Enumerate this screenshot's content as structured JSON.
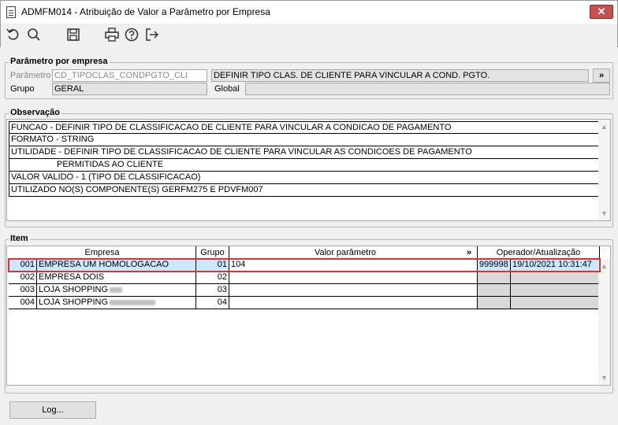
{
  "window": {
    "title": "ADMFM014 - Atribuição de Valor a Parâmetro por Empresa",
    "close_label": "✕"
  },
  "toolbar": {
    "icons": [
      "undo-icon",
      "search-icon",
      "save-icon",
      "print-icon",
      "help-icon",
      "exit-icon"
    ]
  },
  "parametro_group": {
    "title": "Parâmetro por empresa",
    "parametro_label": "Parâmetro",
    "parametro_value": "CD_TIPOCLAS_CONDPGTO_CLI",
    "parametro_desc": "DEFINIR TIPO CLAS. DE CLIENTE PARA VINCULAR A COND. PGTO.",
    "expand_label": "»",
    "grupo_label": "Grupo",
    "grupo_value": "GERAL",
    "global_label": "Global",
    "global_value": ""
  },
  "observacao": {
    "title": "Observação",
    "lines": [
      "FUNCAO - DEFINIR TIPO DE CLASSIFICACAO DE CLIENTE PARA VINCULAR A CONDICAO DE PAGAMENTO",
      "FORMATO - STRING",
      "UTILIDADE - DEFINIR TIPO DE CLASSIFICACAO DE CLIENTE PARA VINCULAR AS CONDICOES DE PAGAMENTO",
      "PERMITIDAS AO CLIENTE",
      "VALOR VALIDO - 1 (TIPO DE CLASSIFICACAO)",
      "UTILIZADO NO(S) COMPONENTE(S) GERFM275 E PDVFM007"
    ]
  },
  "item": {
    "title": "Item",
    "headers": {
      "empresa": "Empresa",
      "grupo": "Grupo",
      "valor": "Valor parâmetro",
      "expand": "»",
      "operador": "Operador/Atualização"
    },
    "rows": [
      {
        "code": "001",
        "name": "EMPRESA UM HOMOLOGACAO",
        "grupo": "01",
        "valor": "104",
        "operador": "999998",
        "atualizacao": "19/10/2021 10:31:47"
      },
      {
        "code": "002",
        "name": "EMPRESA DOIS",
        "grupo": "02",
        "valor": "",
        "operador": "",
        "atualizacao": ""
      },
      {
        "code": "003",
        "name": "LOJA SHOPPING",
        "grupo": "03",
        "valor": "",
        "operador": "",
        "atualizacao": ""
      },
      {
        "code": "004",
        "name": "LOJA SHOPPING",
        "grupo": "04",
        "valor": "",
        "operador": "",
        "atualizacao": ""
      }
    ]
  },
  "footer": {
    "log_label": "Log..."
  },
  "colors": {
    "selection_border": "#e03030",
    "selected_row": "#cce8ff",
    "close_button": "#c75050"
  }
}
